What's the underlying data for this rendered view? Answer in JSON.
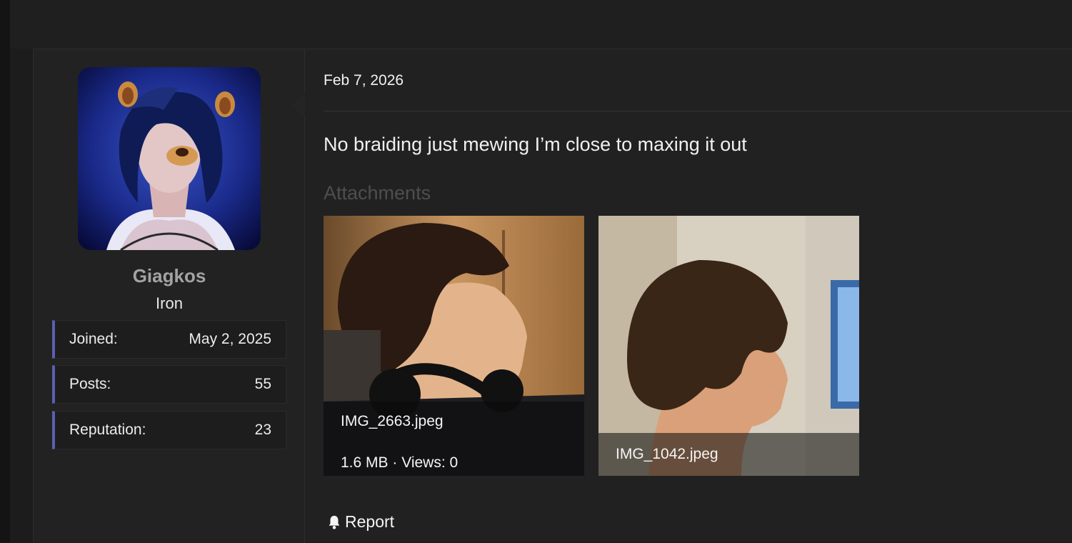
{
  "user": {
    "name": "Giagkos",
    "title": "Iron",
    "stats": [
      {
        "label": "Joined:",
        "value": "May 2, 2025"
      },
      {
        "label": "Posts:",
        "value": "55"
      },
      {
        "label": "Reputation:",
        "value": "23"
      }
    ]
  },
  "post": {
    "date": "Feb 7, 2026",
    "text": "No braiding just mewing I’m close to maxing it out",
    "attachments_label": "Attachments",
    "attachments": [
      {
        "name": "IMG_2663.jpeg",
        "meta": "1.6 MB · Views: 0"
      },
      {
        "name": "IMG_1042.jpeg"
      }
    ],
    "report_label": "Report"
  },
  "colors": {
    "accent": "#5b5fb0",
    "background": "#1c1c1c",
    "panel": "#212121"
  }
}
